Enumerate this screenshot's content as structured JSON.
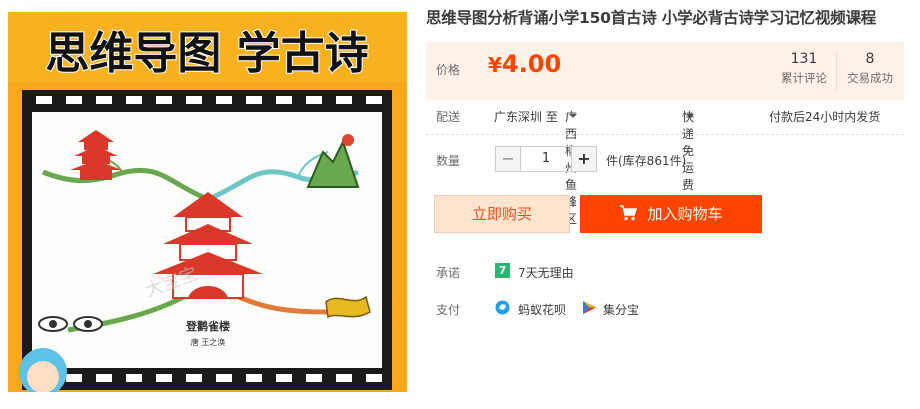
{
  "image": {
    "banner_text": "思维导图 学古诗",
    "poem_title": "登鹳雀楼",
    "poem_author": "唐 王之涣",
    "watermark": "大宝宝"
  },
  "product": {
    "title": "思维导图分析背诵小学150首古诗 小学必背古诗学习记忆视频课程"
  },
  "price": {
    "label": "价格",
    "currency": "¥",
    "amount": "4.00",
    "color": "#ff4400"
  },
  "stats": {
    "reviews_count": "131",
    "reviews_label": "累计评论",
    "sales_count": "8",
    "sales_label": "交易成功"
  },
  "shipping": {
    "label": "配送",
    "origin": "广东深圳 至",
    "destination": "广西柳州鱼峰区",
    "method": "快递 免运费",
    "dispatch": "付款后24小时内发货"
  },
  "quantity": {
    "label": "数量",
    "minus": "−",
    "value": "1",
    "plus": "+",
    "stock": "件(库存861件)"
  },
  "actions": {
    "buy_now": "立即购买",
    "add_to_cart": "加入购物车"
  },
  "promise": {
    "label": "承诺",
    "icon_text": "7",
    "text": "7天无理由"
  },
  "payment": {
    "label": "支付",
    "option1": "蚂蚁花呗",
    "option2": "集分宝"
  }
}
